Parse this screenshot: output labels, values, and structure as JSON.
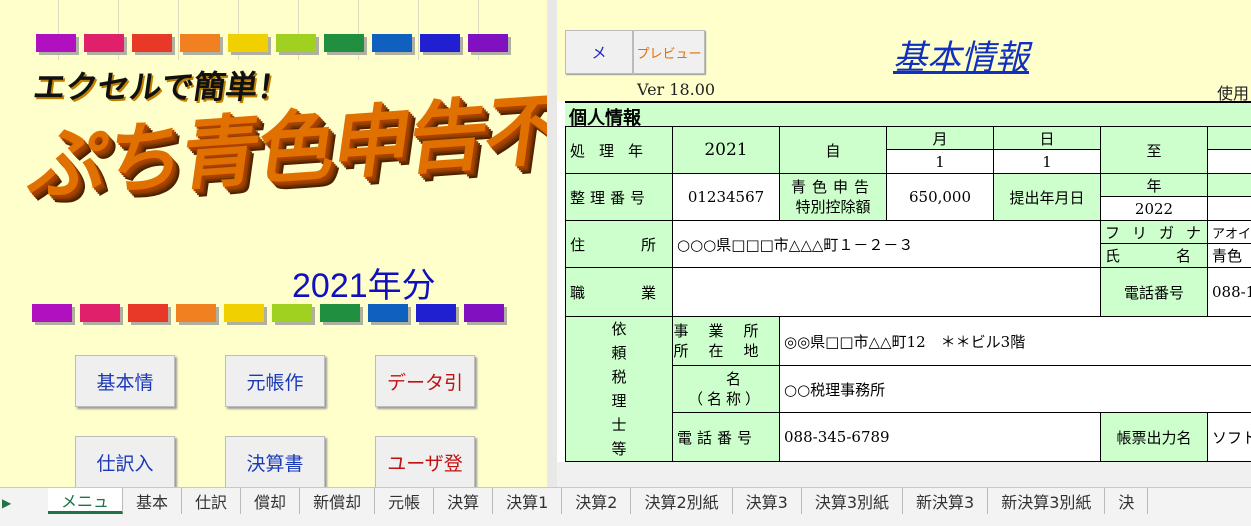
{
  "menu": {
    "banner": "エクセルで簡単！",
    "title_art": "ぷち青色申告不動産",
    "year": "2021年分",
    "rainbow_colors": [
      "#b010c0",
      "#e0206a",
      "#e83828",
      "#f08020",
      "#f0d000",
      "#a0d020",
      "#209040",
      "#1060c0",
      "#2020d0",
      "#8010c0"
    ],
    "buttons": [
      {
        "label": "基本情",
        "color": "#1a3ab8"
      },
      {
        "label": "元帳作",
        "color": "#1a3ab8"
      },
      {
        "label": "データ引",
        "color": "#c01010"
      },
      {
        "label": "仕訳入",
        "color": "#1a3ab8"
      },
      {
        "label": "決算書",
        "color": "#1a3ab8"
      },
      {
        "label": "ユーザ登",
        "color": "#c01010"
      }
    ]
  },
  "sheet": {
    "btn_menu": "メ",
    "btn_preview": "プレビュー",
    "title": "基本情報",
    "version": "Ver 18.00",
    "use_label": "使用",
    "section": "個人情報",
    "labels": {
      "shori_nen": "処理年",
      "ji": "自",
      "tsuki": "月",
      "hi": "日",
      "itaru": "至",
      "seiri_bango": "整理番号",
      "aoiro1": "青色申告",
      "aoiro2": "特別控除額",
      "teishutsu": "提出年月日",
      "nen": "年",
      "jusho": "住所",
      "furigana": "フリガナ",
      "shimei": "氏名",
      "shokugyo": "職業",
      "denwa": "電話番号",
      "irai": [
        "依",
        "頼",
        "税",
        "理",
        "士",
        "等"
      ],
      "jimusho1": "事業所",
      "jimusho2": "所在地",
      "meisho1": "氏名",
      "meisho2": "（名称）",
      "denwa2": "電話番号",
      "chohyo": "帳票出力名"
    },
    "values": {
      "shori_nen": "2021",
      "month": "1",
      "day": "1",
      "seiri_bango": "01234567",
      "kojo": "650,000",
      "teishutsu_year": "2022",
      "jusho": "○○○県□□□市△△△町１－２－３",
      "furigana_val": "アオイロ",
      "shimei_val": "青色",
      "denwa_val": "088-1",
      "jimusho_addr": "◎◎県□□市△△町12　＊＊ビル3階",
      "tax_office": "○○税理事務所",
      "tax_phone": "088-345-6789",
      "chohyo_val": "ソフト"
    }
  },
  "tabs": [
    "メニュ",
    "基本",
    "仕訳",
    "償却",
    "新償却",
    "元帳",
    "決算",
    "決算1",
    "決算2",
    "決算2別紙",
    "決算3",
    "決算3別紙",
    "新決算3",
    "新決算3別紙",
    "決"
  ],
  "active_tab": "メニュ"
}
